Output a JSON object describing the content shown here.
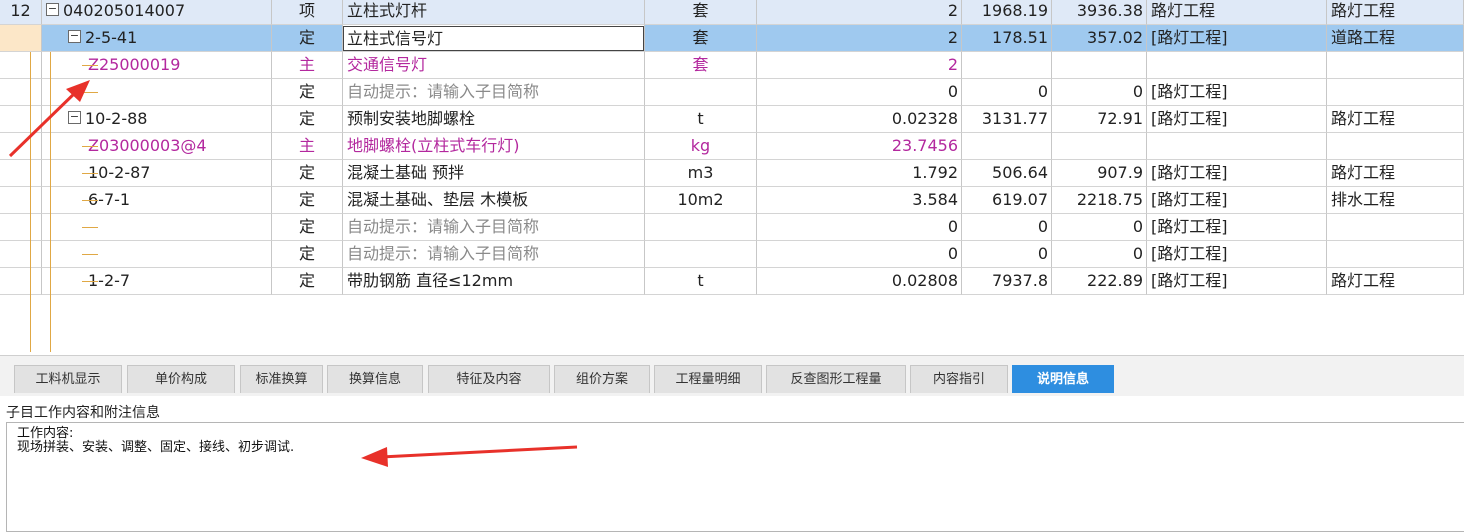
{
  "grid": {
    "rows": [
      {
        "idx": "12",
        "code": "040205014007",
        "code_toggle": "−",
        "type": "项",
        "name": "立柱式灯杆",
        "unit": "套",
        "qty": "2",
        "price": "1968.19",
        "total": "3936.38",
        "prof1": "路灯工程",
        "prof2": "路灯工程",
        "kind": "hdr"
      },
      {
        "idx": "",
        "code": "2-5-41",
        "code_toggle": "−",
        "type": "定",
        "name": "立柱式信号灯",
        "unit": "套",
        "qty": "2",
        "price": "178.51",
        "total": "357.02",
        "prof1": "[路灯工程]",
        "prof2": "道路工程",
        "kind": "sel"
      },
      {
        "idx": "",
        "code": "Z25000019",
        "type": "主",
        "name": "交通信号灯",
        "unit": "套",
        "qty": "2",
        "price": "",
        "total": "",
        "prof1": "",
        "prof2": "",
        "kind": "main"
      },
      {
        "idx": "",
        "code": "",
        "type": "定",
        "name": "自动提示：请输入子目简称",
        "unit": "",
        "qty": "0",
        "price": "0",
        "total": "0",
        "prof1": "[路灯工程]",
        "prof2": "",
        "kind": "hint"
      },
      {
        "idx": "",
        "code": "10-2-88",
        "code_toggle": "−",
        "type": "定",
        "name": "预制安装地脚螺栓",
        "unit": "t",
        "qty": "0.02328",
        "price": "3131.77",
        "total": "72.91",
        "prof1": "[路灯工程]",
        "prof2": "路灯工程",
        "kind": "norm"
      },
      {
        "idx": "",
        "code": "Z03000003@4",
        "type": "主",
        "name": "地脚螺栓(立柱式车行灯)",
        "unit": "kg",
        "qty": "23.7456",
        "price": "",
        "total": "",
        "prof1": "",
        "prof2": "",
        "kind": "main"
      },
      {
        "idx": "",
        "code": "10-2-87",
        "type": "定",
        "name": "混凝土基础 预拌",
        "unit": "m3",
        "qty": "1.792",
        "price": "506.64",
        "total": "907.9",
        "prof1": "[路灯工程]",
        "prof2": "路灯工程",
        "kind": "norm"
      },
      {
        "idx": "",
        "code": "6-7-1",
        "type": "定",
        "name": "混凝土基础、垫层 木模板",
        "unit": "10m2",
        "qty": "3.584",
        "price": "619.07",
        "total": "2218.75",
        "prof1": "[路灯工程]",
        "prof2": "排水工程",
        "kind": "norm"
      },
      {
        "idx": "",
        "code": "",
        "type": "定",
        "name": "自动提示：请输入子目简称",
        "unit": "",
        "qty": "0",
        "price": "0",
        "total": "0",
        "prof1": "[路灯工程]",
        "prof2": "",
        "kind": "hint"
      },
      {
        "idx": "",
        "code": "",
        "type": "定",
        "name": "自动提示：请输入子目简称",
        "unit": "",
        "qty": "0",
        "price": "0",
        "total": "0",
        "prof1": "[路灯工程]",
        "prof2": "",
        "kind": "hint"
      },
      {
        "idx": "",
        "code": "1-2-7",
        "type": "定",
        "name": "带肋钢筋 直径≤12mm",
        "unit": "t",
        "qty": "0.02808",
        "price": "7937.8",
        "total": "222.89",
        "prof1": "[路灯工程]",
        "prof2": "路灯工程",
        "kind": "norm"
      }
    ]
  },
  "tabs": [
    "工料机显示",
    "单价构成",
    "标准换算",
    "换算信息",
    "特征及内容",
    "组价方案",
    "工程量明细",
    "反查图形工程量",
    "内容指引",
    "说明信息"
  ],
  "active_tab": "说明信息",
  "panel": {
    "title": "子目工作内容和附注信息",
    "content_line1": "工作内容:",
    "content_line2": "现场拼装、安装、调整、固定、接线、初步调试."
  },
  "colors": {
    "accent": "#2e8ee0",
    "selected_row": "#9fc9ef",
    "header_row": "#dfe9f7",
    "main_text": "#b3289e",
    "arrow": "#e8312a"
  }
}
